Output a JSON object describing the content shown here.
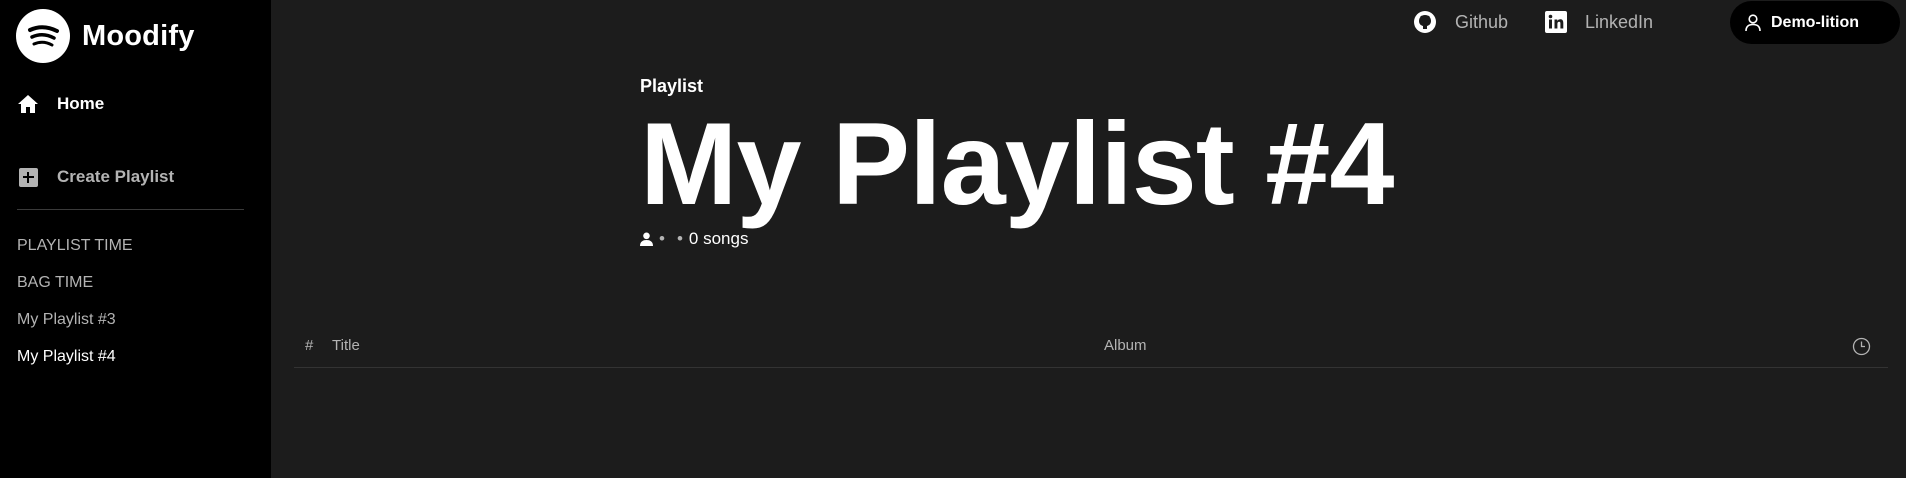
{
  "brand": {
    "name": "Moodify"
  },
  "sidebar": {
    "nav": [
      {
        "label": "Home",
        "icon": "home-icon"
      },
      {
        "label": "Create Playlist",
        "icon": "plus-square-icon"
      }
    ],
    "playlists": [
      "PLAYLIST TIME",
      "BAG TIME",
      "My Playlist #3",
      "My Playlist #4"
    ],
    "active_playlist": "My Playlist #4"
  },
  "topbar": {
    "github_label": "Github",
    "linkedin_label": "LinkedIn",
    "user_label": "Demo-lition"
  },
  "playlist": {
    "kind": "Playlist",
    "title": "My Playlist #4",
    "owner": "",
    "songs": "0 songs"
  },
  "table": {
    "num_header": "#",
    "title_header": "Title",
    "album_header": "Album",
    "duration_icon": "clock-icon"
  },
  "colors": {
    "sidebar_bg": "#000000",
    "main_bg": "#1c1c1c",
    "text": "#ffffff",
    "muted": "#b3b3b3"
  }
}
